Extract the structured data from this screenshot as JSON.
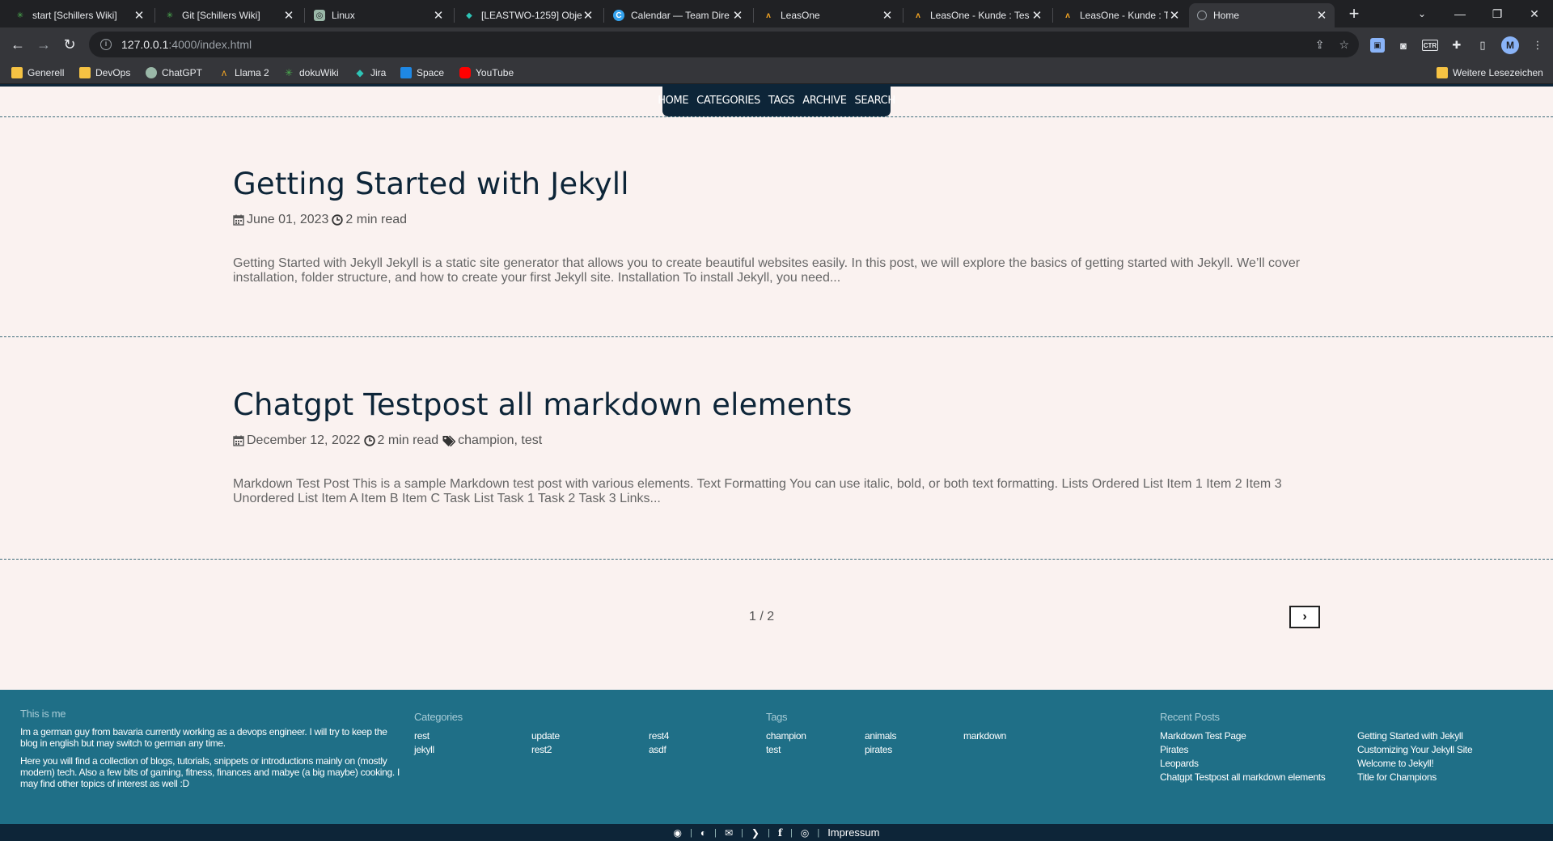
{
  "browser": {
    "tabs": [
      {
        "title": "start [Schillers Wiki]",
        "close": "✕"
      },
      {
        "title": "Git [Schillers Wiki]",
        "close": "✕"
      },
      {
        "title": "Linux",
        "close": "✕"
      },
      {
        "title": "[LEASTWO-1259] Obje",
        "close": "✕"
      },
      {
        "title": "Calendar — Team Dire",
        "close": "✕"
      },
      {
        "title": "LeasOne",
        "close": "✕"
      },
      {
        "title": "LeasOne - Kunde : Tes",
        "close": "✕"
      },
      {
        "title": "LeasOne - Kunde : Tes",
        "close": "✕"
      },
      {
        "title": "Home",
        "close": "✕"
      }
    ],
    "new_tab": "+",
    "url_host": "127.0.0.1",
    "url_rest": ":4000/index.html",
    "avatar_letter": "M",
    "ctr_ext": "CTR",
    "bookmarks": [
      "Generell",
      "DevOps",
      "ChatGPT",
      "Llama 2",
      "dokuWiki",
      "Jira",
      "Space",
      "YouTube"
    ],
    "other_bookmarks": "Weitere Lesezeichen"
  },
  "site": {
    "nav": [
      "HOME",
      "CATEGORIES",
      "TAGS",
      "ARCHIVE",
      "SEARCH"
    ],
    "posts": [
      {
        "title": "Getting Started with Jekyll",
        "date": "June 01, 2023",
        "read_time": "2 min read",
        "tags": "",
        "excerpt": "Getting Started with Jekyll Jekyll is a static site generator that allows you to create beautiful websites easily. In this post, we will explore the basics of getting started with Jekyll. We’ll cover installation, folder structure, and how to create your first Jekyll site. Installation To install Jekyll, you need..."
      },
      {
        "title": "Chatgpt Testpost all markdown elements",
        "date": "December 12, 2022",
        "read_time": "2 min read",
        "tags": "champion, test",
        "excerpt": "Markdown Test Post This is a sample Markdown test post with various elements. Text Formatting You can use italic, bold, or both text formatting. Lists Ordered List Item 1 Item 2 Item 3 Unordered List Item A Item B Item C Task List Task 1 Task 2 Task 3 Links..."
      }
    ],
    "pagination": {
      "label": "1 / 2",
      "next": "›"
    },
    "footer": {
      "about_title": "This is me",
      "about_p1": "Im a german guy from bavaria currently working as a devops engineer. I will try to keep the blog in english but may switch to german any time.",
      "about_p2": "Here you will find a collection of blogs, tutorials, snippets or introductions mainly on (mostly modern) tech. Also a few bits of gaming, fitness, finances and mabye (a big maybe) cooking. I may find other topics of interest as well :D",
      "categories_title": "Categories",
      "categories": [
        "rest",
        "update",
        "rest4",
        "jekyll",
        "rest2",
        "asdf"
      ],
      "tags_title": "Tags",
      "tags": [
        "champion",
        "animals",
        "markdown",
        "test",
        "pirates"
      ],
      "recent_title": "Recent Posts",
      "recent_left": [
        "Markdown Test Page",
        "Pirates",
        "Leopards",
        "Chatgpt Testpost all markdown elements"
      ],
      "recent_right": [
        "Getting Started with Jekyll",
        "Customizing Your Jekyll Site",
        "Welcome to Jekyll!",
        "Title for Champions"
      ],
      "impressum": "Impressum"
    }
  },
  "colors": {
    "nav_bg": "#0d2538",
    "page_bg": "#faf2f0",
    "footer_bg": "#1f6f87",
    "title_color": "#0d2538"
  }
}
